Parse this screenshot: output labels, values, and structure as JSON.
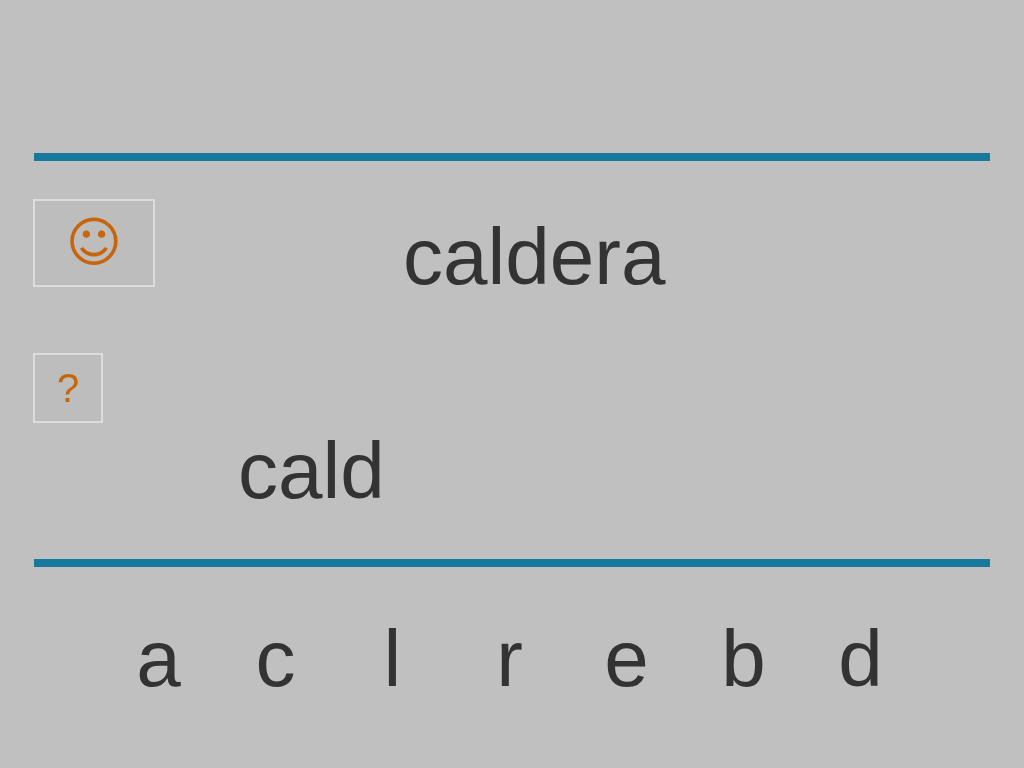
{
  "hint_button": {
    "label": "☺"
  },
  "help_button": {
    "label": "?"
  },
  "target_word": "caldera",
  "answer": "cald",
  "letters": [
    {
      "label": "a"
    },
    {
      "label": "c"
    },
    {
      "label": "l"
    },
    {
      "label": "r"
    },
    {
      "label": "e"
    },
    {
      "label": "b"
    },
    {
      "label": "d"
    }
  ]
}
